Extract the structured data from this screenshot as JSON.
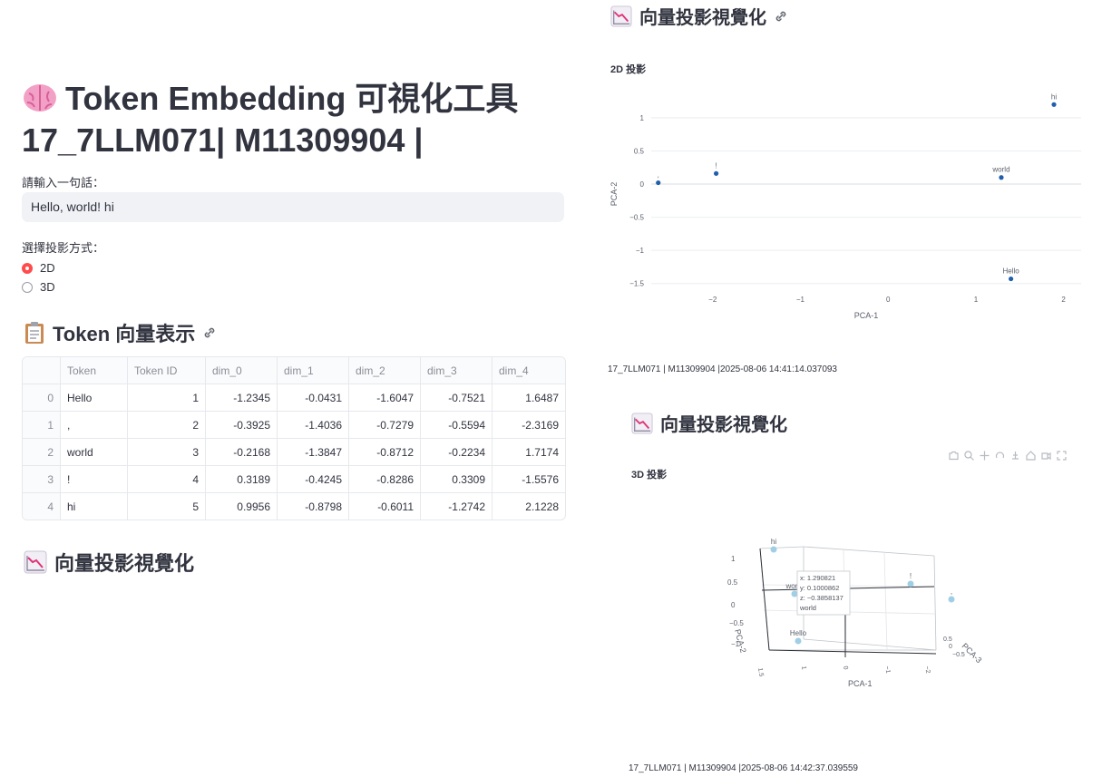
{
  "header": {
    "title_line1": "Token Embedding 可視化工具",
    "title_line2": "17_7LLM071| M11309904 |"
  },
  "input": {
    "label": "請輸入一句話：",
    "value": "Hello, world! hi"
  },
  "projection": {
    "label": "選擇投影方式：",
    "options": [
      "2D",
      "3D"
    ],
    "selected": "2D"
  },
  "token_section": {
    "heading": "Token 向量表示",
    "columns": [
      "",
      "Token",
      "Token ID",
      "dim_0",
      "dim_1",
      "dim_2",
      "dim_3",
      "dim_4"
    ],
    "rows": [
      [
        "0",
        "Hello",
        "1",
        "-1.2345",
        "-0.0431",
        "-1.6047",
        "-0.7521",
        "1.6487"
      ],
      [
        "1",
        ",",
        "2",
        "-0.3925",
        "-1.4036",
        "-0.7279",
        "-0.5594",
        "-2.3169"
      ],
      [
        "2",
        "world",
        "3",
        "-0.2168",
        "-1.3847",
        "-0.8712",
        "-0.2234",
        "1.7174"
      ],
      [
        "3",
        "!",
        "4",
        "0.3189",
        "-0.4245",
        "-0.8286",
        "0.3309",
        "-1.5576"
      ],
      [
        "4",
        "hi",
        "5",
        "0.9956",
        "-0.8798",
        "-0.6011",
        "-1.2742",
        "2.1228"
      ]
    ]
  },
  "viz_section_heading": "向量投影視覺化",
  "chart_data": [
    {
      "type": "scatter",
      "title": "2D 投影",
      "xlabel": "PCA-1",
      "ylabel": "PCA-2",
      "xlim": [
        -2.7,
        2.2
      ],
      "ylim": [
        -1.6,
        1.3
      ],
      "xticks": [
        "−2",
        "−1",
        "0",
        "1",
        "2"
      ],
      "xtick_values": [
        -2,
        -1,
        0,
        1,
        2
      ],
      "yticks": [
        "1",
        "0.5",
        "0",
        "−0.5",
        "−1",
        "−1.5"
      ],
      "ytick_values": [
        1,
        0.5,
        0,
        -0.5,
        -1,
        -1.5
      ],
      "points": [
        {
          "label": ",",
          "x": -2.62,
          "y": 0.02
        },
        {
          "label": "!",
          "x": -1.96,
          "y": 0.16
        },
        {
          "label": "world",
          "x": 1.29,
          "y": 0.1
        },
        {
          "label": "Hello",
          "x": 1.4,
          "y": -1.43
        },
        {
          "label": "hi",
          "x": 1.89,
          "y": 1.2
        }
      ],
      "color": "#1f5fae",
      "caption": "17_7LLM071 | M11309904 |2025-08-06 14:41:14.037093"
    },
    {
      "type": "scatter",
      "title": "3D 投影",
      "xlabel": "PCA-1",
      "ylabel": "PCA-2",
      "zlabel": "PCA-3",
      "points": [
        {
          "label": "hi",
          "x": 1.89,
          "y": 1.2
        },
        {
          "label": "world",
          "x": 1.290821,
          "y": 0.1000862,
          "z": -0.3858137
        },
        {
          "label": "Hello",
          "x": 1.4,
          "y": -1.43
        },
        {
          "label": "!",
          "x": -1.96,
          "y": 0.16
        },
        {
          "label": ",",
          "x": -2.62,
          "y": 0.02
        }
      ],
      "hover": {
        "x": "x: 1.290821",
        "y": "y: 0.1000862",
        "z": "z: −0.3858137",
        "label": "world"
      },
      "color": "#9fcfe6",
      "caption": "17_7LLM071 | M11309904 |2025-08-06 14:42:37.039559"
    }
  ],
  "toolbar_icons": [
    "camera-icon",
    "zoom-icon",
    "pan-icon",
    "orbit-icon",
    "turntable-icon",
    "home-icon",
    "video-icon",
    "fullscreen-icon"
  ]
}
